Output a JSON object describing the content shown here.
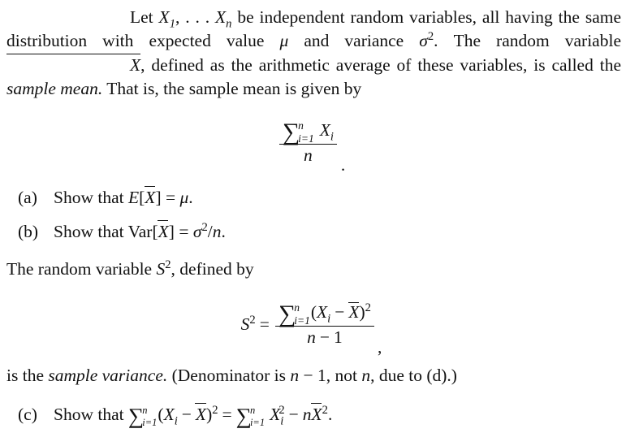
{
  "document": {
    "type": "math-exercise",
    "paragraphs": {
      "intro_line1_indent": "Let",
      "intro": {
        "seg1": "Let ",
        "var_X": "X",
        "sub_1": "1",
        "comma_dots": ", . . . ",
        "var_Xn": "X",
        "sub_n": "n",
        "seg2": " be independent random variables, all having the same distribution with expected value ",
        "mu": "μ",
        "seg3": " and variance ",
        "sigma": "σ",
        "sup_2": "2",
        "seg4": ". The random variable ",
        "xbar": "X",
        "seg5": ", defined as the arithmetic average of these variables, is called the ",
        "emph": "sample mean.",
        "seg6": " That is, the sample mean is given by"
      },
      "svar_intro": {
        "seg1": "The random variable ",
        "S": "S",
        "sup_2": "2",
        "seg2": ", defined by"
      },
      "svar_outro": {
        "seg1": "is the ",
        "emph": "sample variance.",
        "seg2": " (Denominator is ",
        "n": "n",
        "minus": " − ",
        "one": "1",
        "seg3": ", not ",
        "n2": "n",
        "seg4": ", due to (d).)"
      }
    },
    "display_equations": [
      {
        "name": "sample-mean",
        "sigma_glyph": "∑",
        "upper_limit": "n",
        "lower_limit": "i=1",
        "numerator_term": "X",
        "numerator_sub": "i",
        "denominator": "n",
        "trailing_punctuation": "."
      },
      {
        "name": "sample-variance",
        "lhs": "S",
        "lhs_sup": "2",
        "equals": "=",
        "sigma_glyph": "∑",
        "upper_limit": "n",
        "lower_limit": "i=1",
        "open_paren": "(",
        "term_X": "X",
        "term_sub": "i",
        "minus": "−",
        "xbar": "X",
        "close_paren": ")",
        "close_sup": "2",
        "denominator_n": "n",
        "denominator_minus": "−",
        "denominator_one": "1",
        "trailing_punctuation": ","
      }
    ],
    "items": [
      {
        "label": "(a)",
        "text_prefix": "Show that ",
        "E": "E",
        "open_bracket": "[",
        "xbar": "X",
        "close_bracket": "]",
        "equals": " = ",
        "mu": "μ",
        "period": "."
      },
      {
        "label": "(b)",
        "text_prefix": "Show that ",
        "var_op": "Var",
        "open_bracket": "[",
        "xbar": "X",
        "close_bracket": "]",
        "equals": " = ",
        "sigma": "σ",
        "sup_2": "2",
        "slash": "/",
        "n": "n",
        "period": "."
      },
      {
        "label": "(c)",
        "text_prefix": "Show that ",
        "sigma_glyph": "∑",
        "upper_limit": "n",
        "lower_limit": "i=1",
        "open_paren": "(",
        "term_X": "X",
        "term_sub": "i",
        "minus": "−",
        "xbar": "X",
        "close_paren": ")",
        "close_sup": "2",
        "equals": "=",
        "rhs_sigma": "∑",
        "rhs_upper": "n",
        "rhs_lower": "i=1",
        "rhs_X": "X",
        "rhs_sub": "i",
        "rhs_sup": "2",
        "rhs_minus": "−",
        "rhs_n": "n",
        "rhs_xbar": "X",
        "rhs_xbar_sup": "2",
        "period": "."
      }
    ]
  },
  "colors": {
    "text": "#111111",
    "background": "#ffffff"
  }
}
